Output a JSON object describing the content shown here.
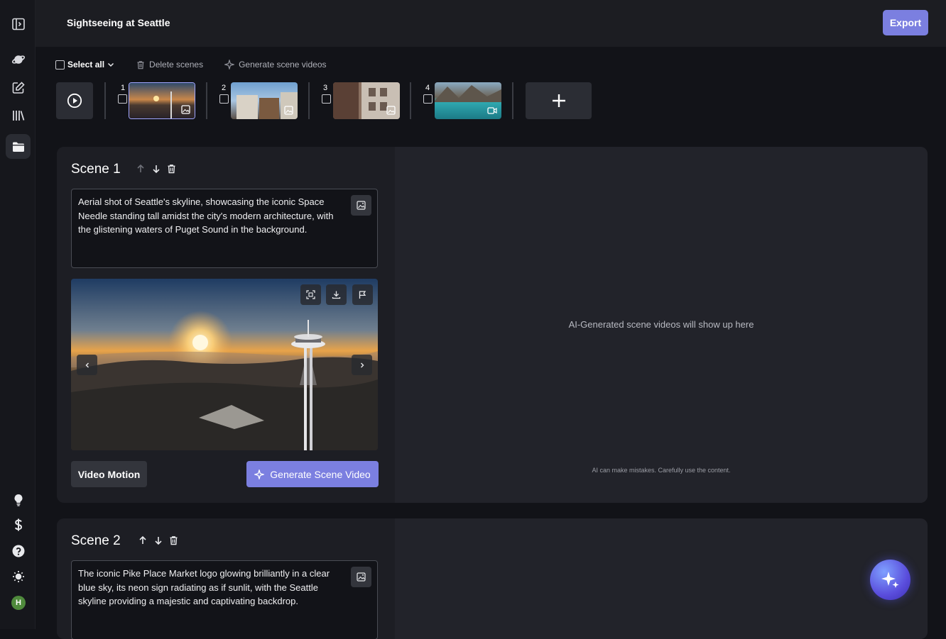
{
  "header": {
    "title": "Sightseeing at Seattle",
    "export_label": "Export"
  },
  "toolbar": {
    "select_all": "Select all",
    "delete_scenes": "Delete scenes",
    "generate_videos": "Generate scene videos"
  },
  "thumbnails": [
    {
      "num": "1",
      "media": "image-icon"
    },
    {
      "num": "2",
      "media": "image-icon"
    },
    {
      "num": "3",
      "media": "image-icon"
    },
    {
      "num": "4",
      "media": "video-icon"
    }
  ],
  "scenes": [
    {
      "title": "Scene 1",
      "prompt": "Aerial shot of Seattle's skyline, showcasing the iconic Space Needle standing tall amidst the city's modern architecture, with the glistening waters of Puget Sound in the background."
    },
    {
      "title": "Scene 2",
      "prompt": "The iconic Pike Place Market logo glowing brilliantly in a clear blue sky, its neon sign radiating as if sunlit, with the Seattle skyline providing a majestic and captivating backdrop."
    }
  ],
  "scene_actions": {
    "video_motion": "Video Motion",
    "generate_video": "Generate Scene Video"
  },
  "videos_panel": {
    "placeholder": "AI-Generated scene videos will show up here",
    "disclaimer": "AI can make mistakes. Carefully use the content."
  },
  "sidebar": {
    "avatar_initial": "H"
  },
  "colors": {
    "accent": "#7b7fe0",
    "background": "#121318",
    "card": "#1d1e24"
  }
}
